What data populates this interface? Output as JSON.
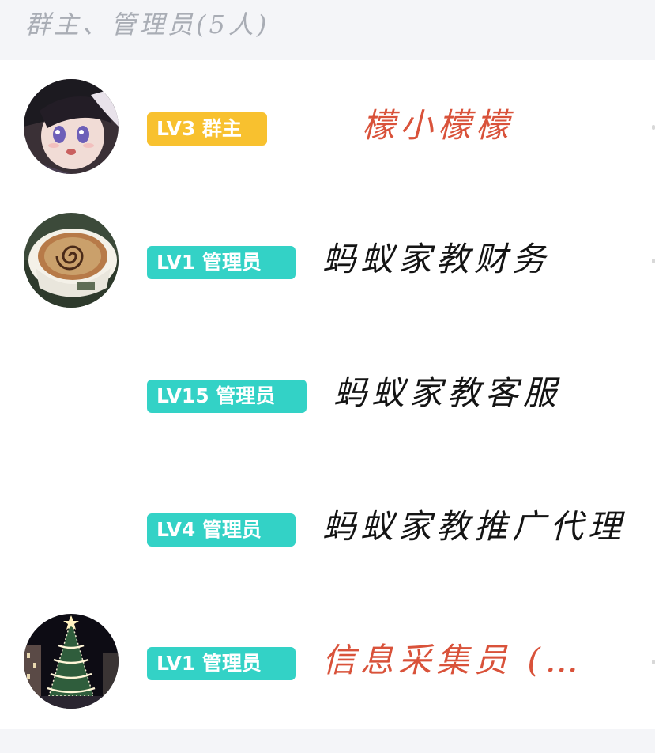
{
  "header": {
    "title": "群主、管理员(5人)"
  },
  "colors": {
    "owner_badge": "#f8c12f",
    "admin_badge": "#33d2c6",
    "highlight_name": "#d9523a",
    "name": "#141414"
  },
  "members": [
    {
      "badge": "LV3 群主",
      "role": "owner",
      "nickname": "檬小檬檬",
      "avatar": "anime-girl-avatar",
      "name_color": "red"
    },
    {
      "badge": "LV1 管理员",
      "role": "admin",
      "nickname": "蚂蚁家教财务",
      "avatar": "coffee-cup-avatar",
      "name_color": "dark"
    },
    {
      "badge": "LV15 管理员",
      "role": "admin",
      "nickname": "蚂蚁家教客服",
      "avatar": "",
      "name_color": "dark"
    },
    {
      "badge": "LV4 管理员",
      "role": "admin",
      "nickname": "蚂蚁家教推广代理",
      "avatar": "",
      "name_color": "dark"
    },
    {
      "badge": "LV1 管理员",
      "role": "admin",
      "nickname": "信息采集员 (…",
      "avatar": "christmas-tree-avatar",
      "name_color": "red"
    }
  ]
}
